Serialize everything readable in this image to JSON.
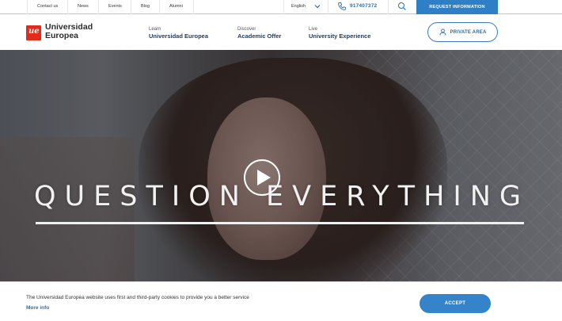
{
  "topbar": {
    "links": [
      "Contact us",
      "News",
      "Events",
      "Blog",
      "Alumni"
    ],
    "language": "English",
    "phone": "917407372",
    "request_label": "REQUEST INFORMATION"
  },
  "brand": {
    "logo_mark": "ue",
    "name_line1": "Universidad",
    "name_line2": "Europea"
  },
  "nav": {
    "items": [
      {
        "small": "Learn",
        "big": "Universidad Europea"
      },
      {
        "small": "Discover",
        "big": "Academic Offer"
      },
      {
        "small": "Live",
        "big": "University Experience"
      }
    ],
    "private_area_label": "PRIVATE AREA"
  },
  "hero": {
    "title": "QUESTION EVERYTHING"
  },
  "cookie": {
    "text": "The Universidad Europea website uses first and third-party cookies to provide you a better service",
    "more_info": "More info",
    "accept_label": "ACCEPT"
  },
  "colors": {
    "brand_red": "#e32b1c",
    "accent_blue": "#2f7fc6",
    "navy": "#1f3b57"
  },
  "icons": [
    "chevron-down-icon",
    "phone-icon",
    "search-icon",
    "user-icon",
    "play-icon"
  ]
}
